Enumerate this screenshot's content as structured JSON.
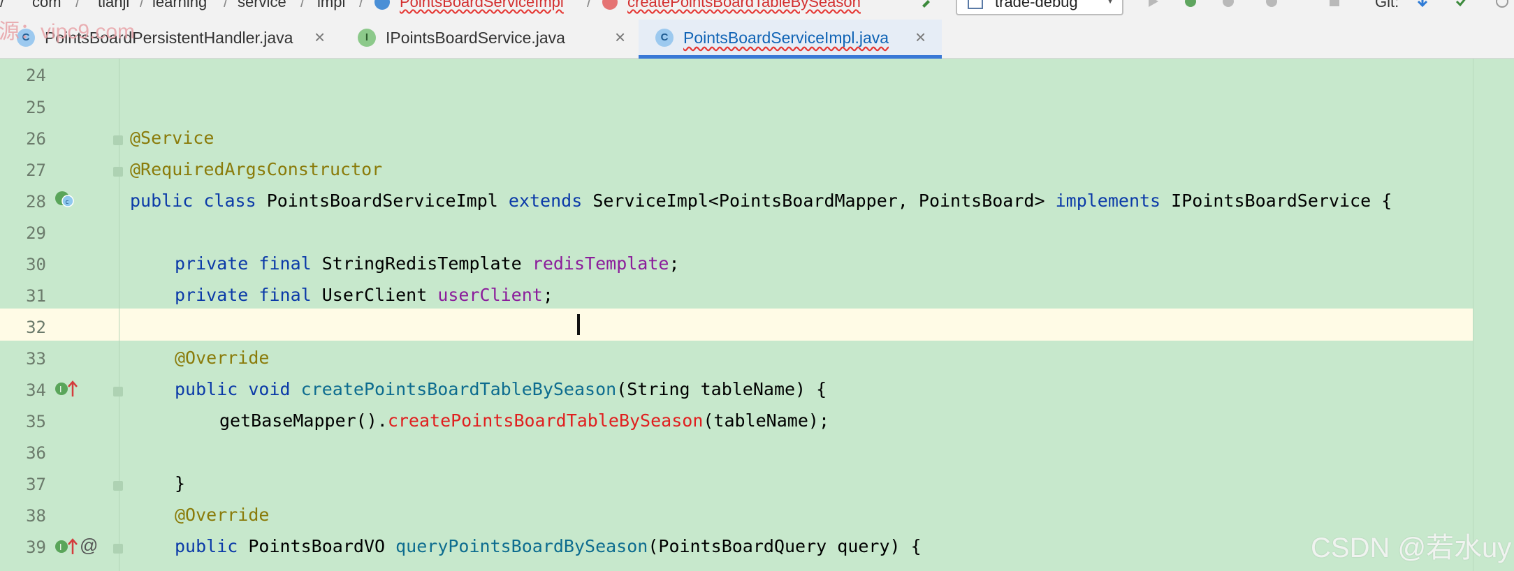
{
  "breadcrumb": {
    "items": [
      "com",
      "tianji",
      "learning",
      "service",
      "impl",
      "PointsBoardServiceImpl",
      "createPointsBoardTableBySeason"
    ]
  },
  "toolbar": {
    "run_config": "trade-debug",
    "vcs_label": "Git:"
  },
  "watermark_top": "源：vipc9.com",
  "tabs": [
    {
      "label": "PointsBoardPersistentHandler.java",
      "icon": "class-icon",
      "icon_letter": "C",
      "active": false
    },
    {
      "label": "IPointsBoardService.java",
      "icon": "interface-icon",
      "icon_letter": "I",
      "active": false
    },
    {
      "label": "PointsBoardServiceImpl.java",
      "icon": "class-icon",
      "icon_letter": "C",
      "active": true
    }
  ],
  "close_glyph": "×",
  "editor": {
    "current_line": "35",
    "lines": [
      {
        "n": "24"
      },
      {
        "n": "25"
      },
      {
        "n": "26",
        "t": [
          "@Service"
        ]
      },
      {
        "n": "27",
        "t": [
          "@RequiredArgsConstructor"
        ]
      },
      {
        "n": "28",
        "t": [
          "public class",
          "PointsBoardServiceImpl",
          "extends",
          "ServiceImpl<PointsBoardMapper, PointsBoard>",
          "implements",
          "IPointsBoardService {"
        ]
      },
      {
        "n": "29"
      },
      {
        "n": "30",
        "t": [
          "private final",
          "StringRedisTemplate",
          "redisTemplate",
          ";"
        ]
      },
      {
        "n": "31",
        "t": [
          "private final",
          "UserClient",
          "userClient",
          ";"
        ]
      },
      {
        "n": "32"
      },
      {
        "n": "33",
        "t": [
          "@Override"
        ]
      },
      {
        "n": "34",
        "t": [
          "public void",
          "createPointsBoardTableBySeason",
          "(String tableName) {"
        ]
      },
      {
        "n": "35",
        "t": [
          "getBaseMapper().",
          "createPointsBoardTableBySeason",
          "(tableName);"
        ]
      },
      {
        "n": "36"
      },
      {
        "n": "37",
        "t": [
          "}"
        ]
      },
      {
        "n": "38",
        "t": [
          "@Override"
        ]
      },
      {
        "n": "39",
        "t": [
          "public",
          "PointsBoardVO",
          "queryPointsBoardBySeason",
          "(PointsBoardQuery query) {"
        ]
      }
    ]
  },
  "watermark_bottom": "CSDN @若水uy",
  "colors": {
    "editor_bg": "#c7e8cc",
    "keyword": "#0b3aa8",
    "annotation": "#8a7b0a",
    "field": "#8b1d9b",
    "method": "#0d6c8f",
    "error_method": "#e01f1f",
    "current_line_bg": "#fffbe6",
    "active_tab_underline": "#3878d6"
  }
}
